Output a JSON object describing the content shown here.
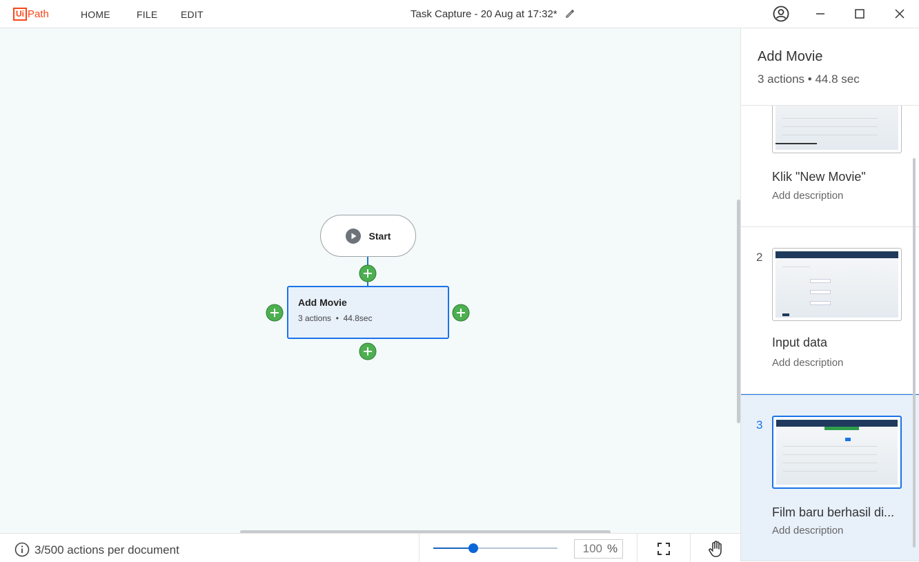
{
  "app": {
    "logo": "UiPath",
    "menu": [
      "HOME",
      "FILE",
      "EDIT"
    ],
    "document_title": "Task Capture - 20 Aug at 17:32*",
    "icons": [
      "account-icon",
      "minimize-icon",
      "maximize-icon",
      "close-icon",
      "edit-icon"
    ]
  },
  "canvas": {
    "start_label": "Start",
    "activity": {
      "name": "Add Movie",
      "actions": "3 actions",
      "separator": "•",
      "duration": "44.8sec"
    }
  },
  "status": {
    "actions_count": "3/500 actions per document",
    "zoom_value": "100",
    "zoom_unit": "%",
    "zoom_fraction": 0.32
  },
  "panel": {
    "title": "Add Movie",
    "subtitle": "3 actions • 44.8 sec",
    "steps": [
      {
        "number": "",
        "title": "Klik \"New Movie\"",
        "description": "Add description"
      },
      {
        "number": "2",
        "title": "Input data",
        "description": "Add description"
      },
      {
        "number": "3",
        "title": "Film baru berhasil di...",
        "description": "Add description"
      }
    ]
  },
  "colors": {
    "brand": "#fa4616",
    "accent": "#1a73e8",
    "add_button": "#4caf50",
    "canvas_bg": "#f4f9fa",
    "selected_bg": "#e8f0fa"
  }
}
